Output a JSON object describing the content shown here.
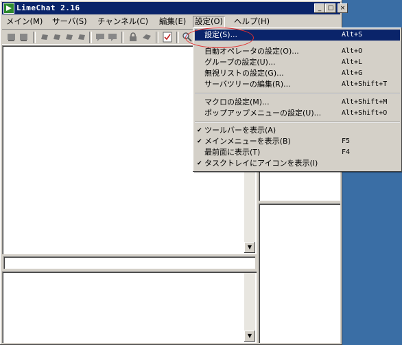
{
  "window": {
    "title": "LimeChat 2.16",
    "controls": {
      "minimize": "_",
      "maximize": "□",
      "close": "×"
    }
  },
  "menubar": {
    "items": [
      {
        "id": "main",
        "label": "メイン(M)"
      },
      {
        "id": "server",
        "label": "サーバ(S)"
      },
      {
        "id": "channel",
        "label": "チャンネル(C)"
      },
      {
        "id": "edit",
        "label": "編集(E)"
      },
      {
        "id": "settings",
        "label": "設定(O)"
      },
      {
        "id": "help",
        "label": "ヘルプ(H)"
      }
    ],
    "active": "settings"
  },
  "settings_menu": {
    "items": [
      {
        "label": "設定(S)...",
        "shortcut": "Alt+S",
        "checked": false,
        "highlighted": true
      },
      {
        "label": "自動オペレータの設定(O)...",
        "shortcut": "Alt+O",
        "checked": false
      },
      {
        "label": "グループの設定(U)...",
        "shortcut": "Alt+L",
        "checked": false
      },
      {
        "label": "無視リストの設定(G)...",
        "shortcut": "Alt+G",
        "checked": false
      },
      {
        "label": "サーバツリーの編集(R)...",
        "shortcut": "Alt+Shift+T",
        "checked": false
      },
      {
        "label": "マクロの設定(M)...",
        "shortcut": "Alt+Shift+M",
        "checked": false
      },
      {
        "label": "ポップアップメニューの設定(U)...",
        "shortcut": "Alt+Shift+O",
        "checked": false
      },
      {
        "label": "ツールバーを表示(A)",
        "shortcut": "",
        "checked": true
      },
      {
        "label": "メインメニューを表示(B)",
        "shortcut": "F5",
        "checked": true
      },
      {
        "label": "最前面に表示(T)",
        "shortcut": "F4",
        "checked": false
      },
      {
        "label": "タスクトレイにアイコンを表示(I)",
        "shortcut": "",
        "checked": true
      }
    ],
    "check_glyph": "✔"
  },
  "scroll": {
    "down_arrow": "▼"
  },
  "colors": {
    "titlebar": "#0a246a",
    "desktop": "#3a6ea5",
    "highlight": "#0a246a",
    "annotation": "#e03030"
  },
  "icons": [
    "app-icon",
    "server-icon",
    "toolbar-icon",
    "lock-icon",
    "checklist-icon",
    "search-icon"
  ]
}
